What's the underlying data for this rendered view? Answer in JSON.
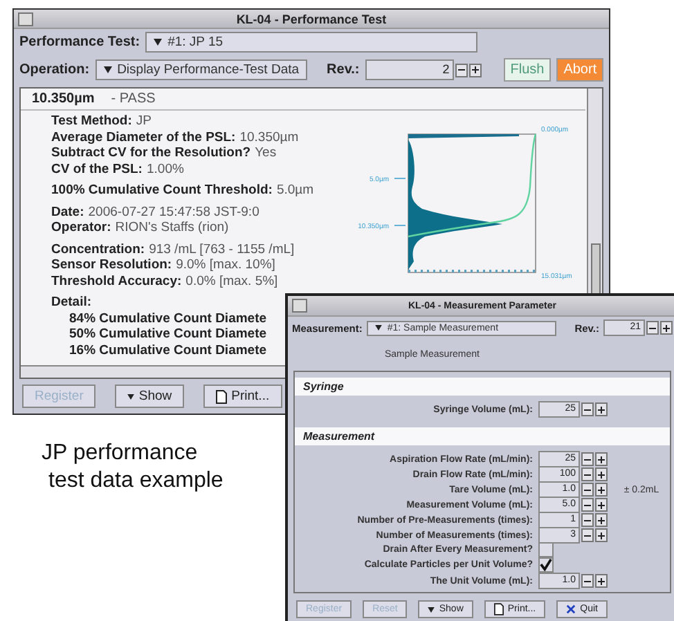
{
  "main_window": {
    "title": "KL-04 - Performance Test",
    "performance_test": {
      "label": "Performance Test:",
      "value": "#1: JP 15"
    },
    "operation": {
      "label": "Operation:",
      "value": "Display Performance-Test Data"
    },
    "rev": {
      "label": "Rev.:",
      "value": "2"
    },
    "top_buttons": [
      {
        "label": "Flush",
        "kind": "flush",
        "disabled": true
      },
      {
        "label": "Abort",
        "kind": "abort",
        "disabled": false
      }
    ],
    "header": {
      "size": "10.350µm",
      "result": "- PASS"
    },
    "info_groups": [
      [
        {
          "label": "Test Method:",
          "value": "JP"
        },
        {
          "label": "Average Diameter of the PSL:",
          "value": "10.350µm"
        },
        {
          "label": "Subtract CV for the Resolution?",
          "value": "Yes"
        },
        {
          "label": "CV of the PSL:",
          "value": "1.00%"
        }
      ],
      [
        {
          "label": "100% Cumulative Count Threshold:",
          "value": "5.0µm"
        }
      ],
      [
        {
          "label": "Date:",
          "value": "2006-07-27 15:47:58 JST-9:0"
        },
        {
          "label": "Operator:",
          "value": "RION's Staffs (rion)"
        }
      ],
      [
        {
          "label": "Concentration:",
          "value": "913 /mL  [763 - 1155 /mL]"
        },
        {
          "label": "Sensor Resolution:",
          "value": "9.0%  [max. 10%]"
        },
        {
          "label": "Threshold Accuracy:",
          "value": "0.0%  [max. 5%]"
        }
      ]
    ],
    "detail": {
      "label": "Detail:",
      "lines": [
        "84% Cumulative Count Diamete",
        "50% Cumulative Count Diamete",
        "16% Cumulative Count Diamete"
      ]
    },
    "chart_labels": [
      {
        "text": "0.000µm",
        "kind": "top"
      },
      {
        "text": "5.0µm",
        "kind": "left-upper"
      },
      {
        "text": "10.350µm",
        "kind": "left-lower"
      },
      {
        "text": "15.031µm",
        "kind": "bottom"
      }
    ],
    "bottom_buttons": [
      {
        "label": "Register",
        "kind": "register",
        "disabled": true
      },
      {
        "label": "Show",
        "kind": "show",
        "disabled": false
      },
      {
        "label": "Print...",
        "kind": "print",
        "disabled": false
      }
    ]
  },
  "param_window": {
    "title": "KL-04 - Measurement Parameter",
    "measurement": {
      "label": "Measurement:",
      "value": "#1: Sample Measurement"
    },
    "rev": {
      "label": "Rev.:",
      "value": "21"
    },
    "name": "Sample Measurement",
    "sections": [
      {
        "title": "Syringe",
        "rows": [
          {
            "kind": "spinner",
            "label": "Syringe Volume (mL):",
            "value": "25"
          }
        ]
      },
      {
        "title": "Measurement",
        "rows": [
          {
            "kind": "spinner",
            "label": "Aspiration Flow Rate (mL/min):",
            "value": "25"
          },
          {
            "kind": "spinner",
            "label": "Drain Flow Rate (mL/min):",
            "value": "100"
          },
          {
            "kind": "spinner",
            "label": "Tare Volume (mL):",
            "value": "1.0",
            "note": "± 0.2mL"
          },
          {
            "kind": "spinner",
            "label": "Measurement Volume (mL):",
            "value": "5.0"
          },
          {
            "kind": "spinner",
            "label": "Number of Pre-Measurements (times):",
            "value": "1"
          },
          {
            "kind": "spinner",
            "label": "Number of Measurements (times):",
            "value": "3"
          },
          {
            "kind": "checkbox",
            "label": "Drain After Every Measurement?",
            "checked": false
          },
          {
            "kind": "checkbox",
            "label": "Calculate Particles per Unit Volume?",
            "checked": true
          },
          {
            "kind": "spinner",
            "label": "The Unit Volume (mL):",
            "value": "1.0"
          }
        ]
      }
    ],
    "buttons": [
      {
        "label": "Register",
        "kind": "register",
        "disabled": true
      },
      {
        "label": "Reset",
        "kind": "reset",
        "disabled": true
      },
      {
        "label": "Show",
        "kind": "show",
        "disabled": false
      },
      {
        "label": "Print...",
        "kind": "print",
        "disabled": false
      },
      {
        "label": "Quit",
        "kind": "quit",
        "disabled": false
      }
    ]
  },
  "caption": [
    "JP performance",
    "test data example"
  ]
}
